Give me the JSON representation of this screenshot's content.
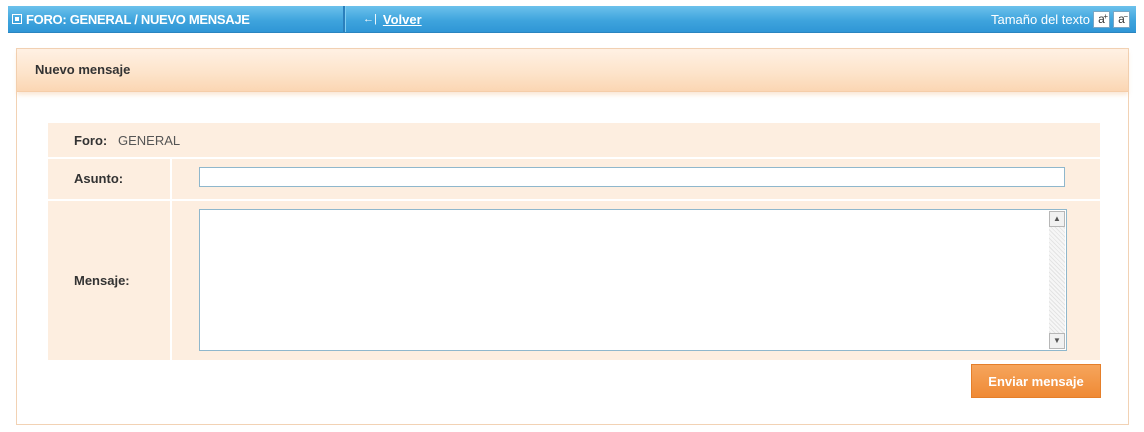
{
  "header": {
    "breadcrumb": "FORO: GENERAL / NUEVO MENSAJE",
    "back_label": "Volver",
    "font_size_label": "Tamaño del texto",
    "font_increase_label": "a",
    "font_decrease_label": "a"
  },
  "panel": {
    "title": "Nuevo mensaje"
  },
  "form": {
    "foro_label": "Foro:",
    "foro_value": "GENERAL",
    "asunto_label": "Asunto:",
    "asunto_value": "",
    "mensaje_label": "Mensaje:",
    "mensaje_value": "",
    "submit_label": "Enviar mensaje"
  },
  "colors": {
    "header_blue": "#3fa4dd",
    "panel_orange": "#fde3c9",
    "button_orange": "#ef8a35"
  }
}
